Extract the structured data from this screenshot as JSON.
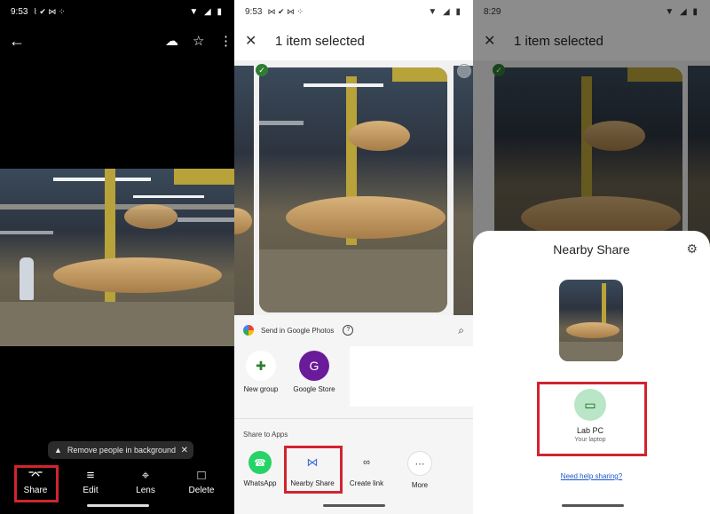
{
  "panel1": {
    "status": {
      "time": "9:53",
      "notif_icons": "⌇ ✔ ⋈ ⁘",
      "system_icons": "▼ ◢ ▮"
    },
    "icons": {
      "back": "←",
      "cloud": "☁",
      "star": "☆",
      "more": "⋮"
    },
    "chip": {
      "icon": "▲",
      "text": "Remove people in background",
      "close": "✕"
    },
    "actions": [
      {
        "label": "Share",
        "icon": "⌤"
      },
      {
        "label": "Edit",
        "icon": "≡"
      },
      {
        "label": "Lens",
        "icon": "⌖"
      },
      {
        "label": "Delete",
        "icon": "□"
      }
    ]
  },
  "panel2": {
    "status": {
      "time": "9:53",
      "notif_icons": "⋈ ✔ ⋈ ⁘",
      "system_icons": "▼ ◢ ▮"
    },
    "header": {
      "close": "✕",
      "title": "1 item selected"
    },
    "check": "✓",
    "google_photos": {
      "label": "Send in Google Photos",
      "help": "?",
      "search_icon": "⌕"
    },
    "targets": [
      {
        "label": "New group",
        "icon": "✚"
      },
      {
        "label": "Google Store",
        "initial": "G"
      }
    ],
    "share_to_apps": "Share to Apps",
    "apps": [
      {
        "label": "WhatsApp",
        "icon": "☎"
      },
      {
        "label": "Nearby Share",
        "icon": "⋈"
      },
      {
        "label": "Create link",
        "icon": "∞"
      },
      {
        "label": "More",
        "icon": "⋯"
      }
    ]
  },
  "panel3": {
    "status": {
      "time": "8:29",
      "system_icons": "▼ ◢ ▮"
    },
    "header": {
      "close": "✕",
      "title": "1 item selected"
    },
    "check": "✓",
    "nearby": {
      "title": "Nearby Share",
      "gear": "⚙",
      "device": {
        "name": "Lab PC",
        "subtitle": "Your laptop",
        "icon": "▭"
      },
      "help_link": "Need help sharing?"
    }
  },
  "colors": {
    "accent_red": "#d12430",
    "google_store_purple": "#6a1b9a",
    "whatsapp_green": "#25d366",
    "link_blue": "#1a57c9"
  }
}
